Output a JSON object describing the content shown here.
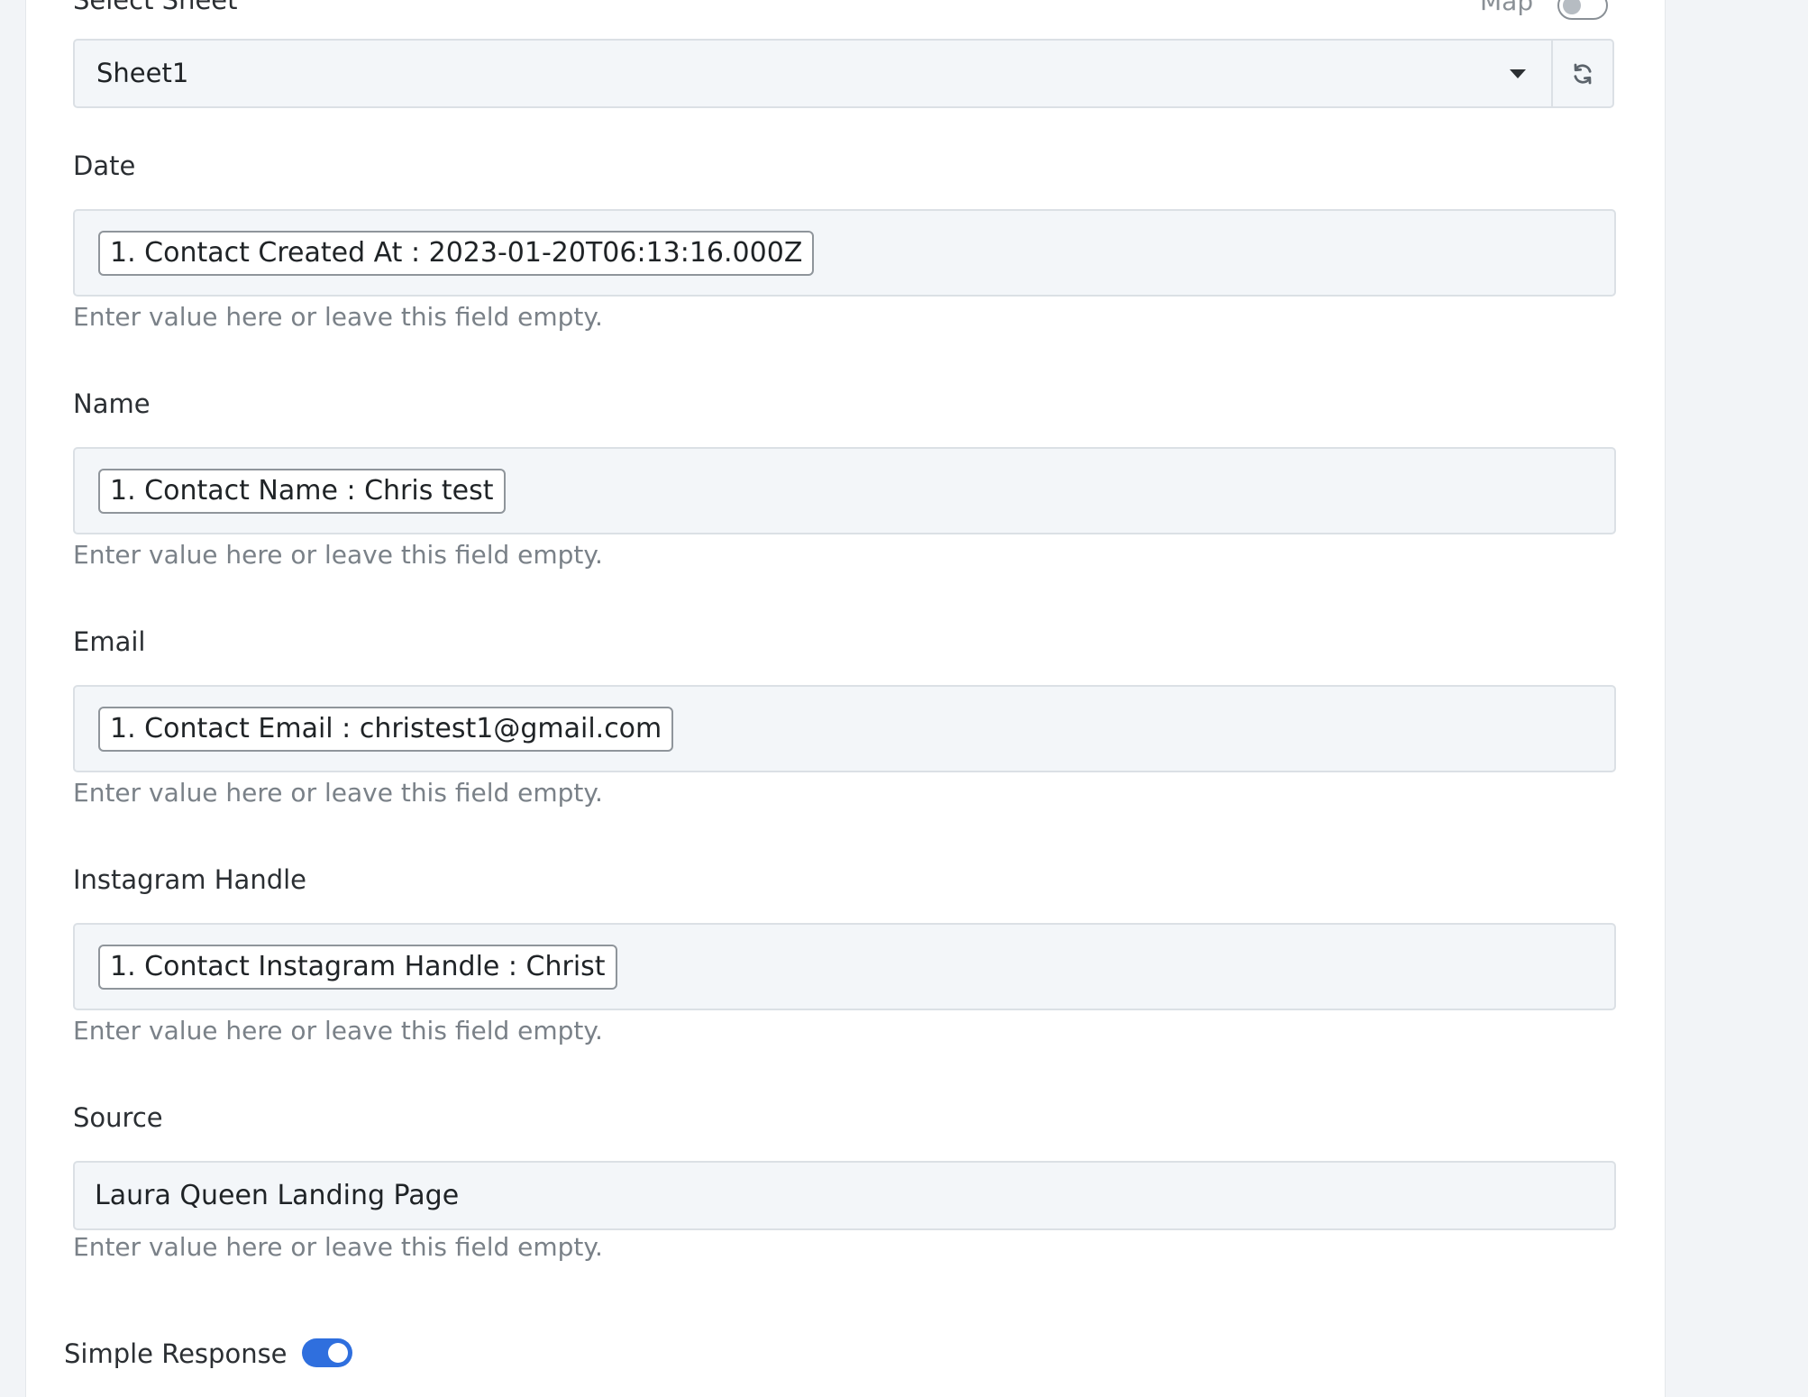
{
  "sheet": {
    "label": "Select Sheet",
    "map_label": "Map",
    "map_toggle_on": false,
    "selected": "Sheet1",
    "refresh_icon": "refresh-icon",
    "dropdown_icon": "caret-down-icon"
  },
  "fields": {
    "date": {
      "label": "Date",
      "chip": "1. Contact Created At : 2023-01-20T06:13:16.000Z",
      "help": "Enter value here or leave this field empty."
    },
    "name": {
      "label": "Name",
      "chip": "1. Contact Name : Chris test",
      "help": "Enter value here or leave this field empty."
    },
    "email": {
      "label": "Email",
      "chip": "1. Contact Email : christest1@gmail.com",
      "help": "Enter value here or leave this field empty."
    },
    "instagram": {
      "label": "Instagram Handle",
      "chip": "1. Contact Instagram Handle : Christ",
      "help": "Enter value here or leave this field empty."
    },
    "source": {
      "label": "Source",
      "value": "Laura Queen Landing Page",
      "help": "Enter value here or leave this field empty."
    }
  },
  "simple_response": {
    "label": "Simple Response",
    "toggle_on": true
  },
  "colors": {
    "accent": "#2f6fde",
    "field_bg": "#f3f6f9",
    "help_text": "#7a8188"
  }
}
